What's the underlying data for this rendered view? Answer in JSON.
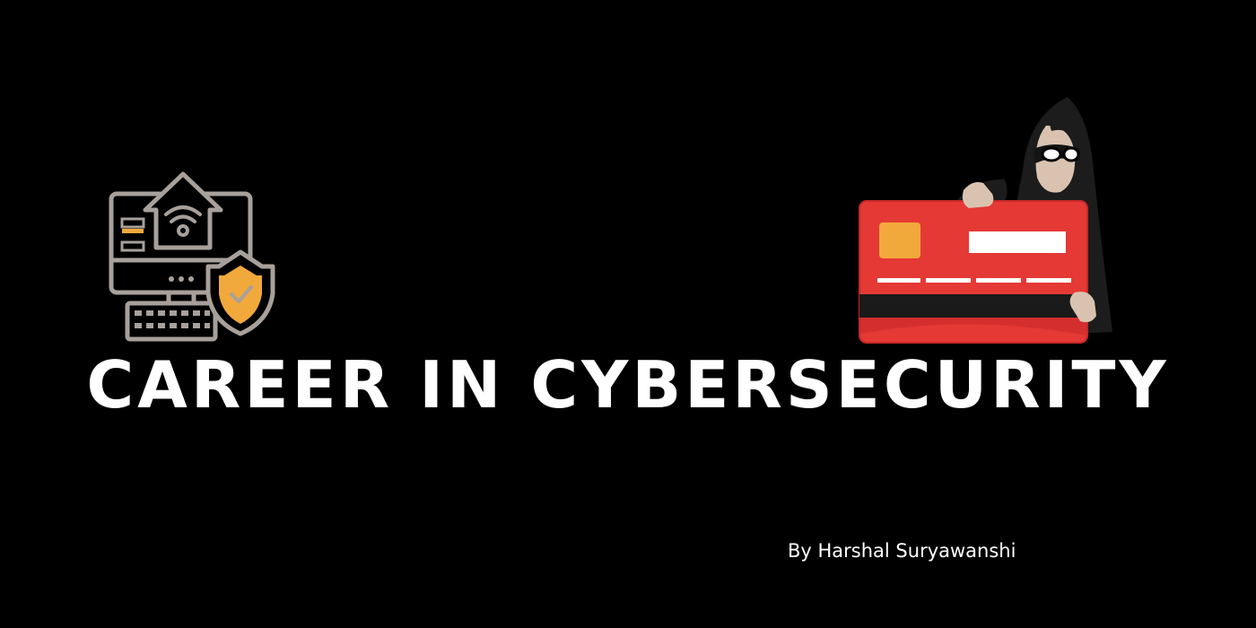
{
  "title": "CAREER IN CYBERSECURITY",
  "byline": "By Harshal Suryawanshi",
  "colors": {
    "background": "#000000",
    "text": "#ffffff",
    "outline": "#a8a09a",
    "accent_orange": "#f2a93b",
    "card_red": "#e53935",
    "hood": "#1c1c1c",
    "skin": "#d9c3b0"
  },
  "illustrations": {
    "left": "computer-security-icon",
    "right": "hacker-with-credit-card-icon"
  }
}
